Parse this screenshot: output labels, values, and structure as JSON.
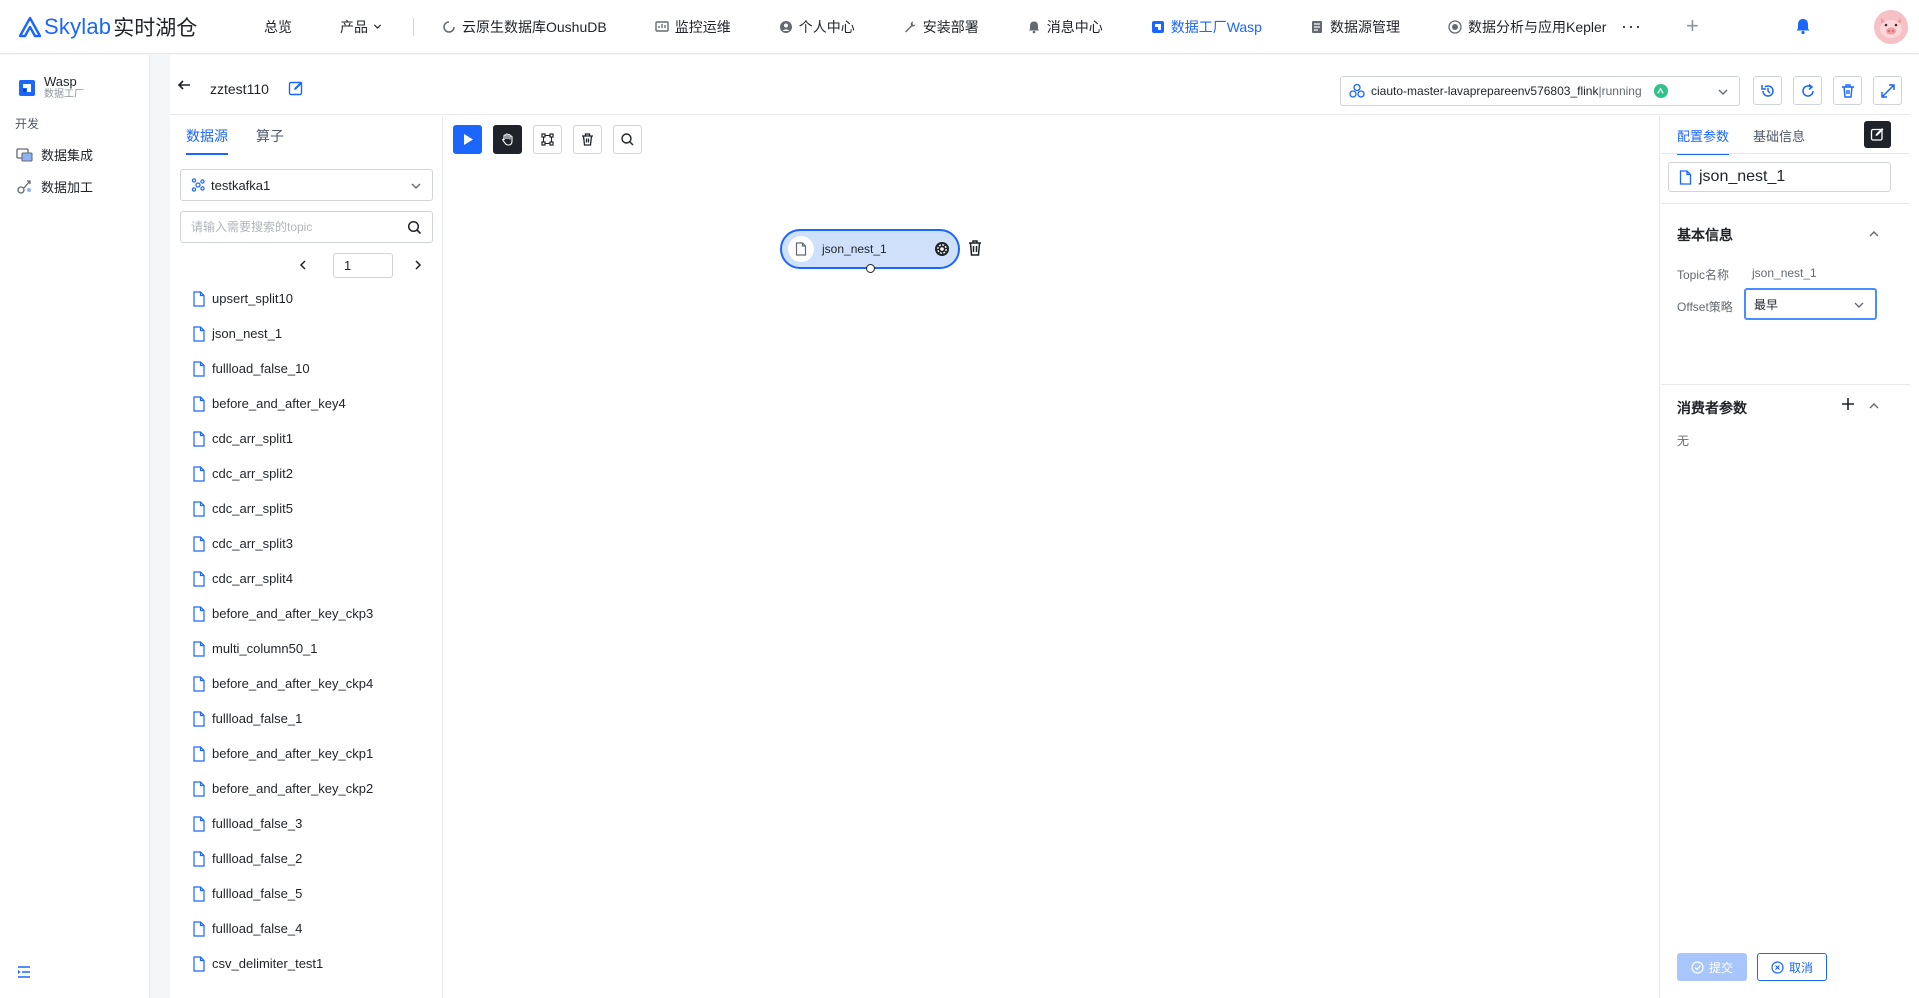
{
  "brand": {
    "name": "Skylab",
    "name_cn": "实时湖仓"
  },
  "nav": {
    "items": [
      {
        "label": "总览"
      },
      {
        "label": "产品"
      },
      {
        "label": "云原生数据库OushuDB"
      },
      {
        "label": "监控运维"
      },
      {
        "label": "个人中心"
      },
      {
        "label": "安装部署"
      },
      {
        "label": "消息中心"
      },
      {
        "label": "数据工厂Wasp"
      },
      {
        "label": "数据源管理"
      },
      {
        "label": "数据分析与应用Kepler"
      }
    ],
    "more": "···",
    "add": "+"
  },
  "sidebar": {
    "app_title": "Wasp",
    "app_subtitle": "数据工厂",
    "group": "开发",
    "items": [
      {
        "label": "数据集成"
      },
      {
        "label": "数据加工"
      }
    ]
  },
  "job": {
    "name": "zztest110"
  },
  "cluster": {
    "name": "ciauto-master-lavaprepareenv576803_flink",
    "status": "running"
  },
  "source_panel": {
    "tabs": [
      {
        "label": "数据源"
      },
      {
        "label": "算子"
      }
    ],
    "kafka_source": "testkafka1",
    "search_placeholder": "请输入需要搜索的topic",
    "page": "1",
    "topics": [
      "upsert_split10",
      "json_nest_1",
      "fullload_false_10",
      "before_and_after_key4",
      "cdc_arr_split1",
      "cdc_arr_split2",
      "cdc_arr_split5",
      "cdc_arr_split3",
      "cdc_arr_split4",
      "before_and_after_key_ckp3",
      "multi_column50_1",
      "before_and_after_key_ckp4",
      "fullload_false_1",
      "before_and_after_key_ckp1",
      "before_and_after_key_ckp2",
      "fullload_false_3",
      "fullload_false_2",
      "fullload_false_5",
      "fullload_false_4",
      "csv_delimiter_test1"
    ]
  },
  "canvas": {
    "node_label": "json_nest_1"
  },
  "config": {
    "tabs": [
      {
        "label": "配置参数"
      },
      {
        "label": "基础信息"
      }
    ],
    "node_name": "json_nest_1",
    "basic_title": "基本信息",
    "topic_label": "Topic名称",
    "topic_value": "json_nest_1",
    "offset_label": "Offset策略",
    "offset_value": "最早",
    "consumer_title": "消费者参数",
    "consumer_empty": "无",
    "submit_label": "提交",
    "cancel_label": "取消"
  },
  "colors": {
    "primary": "#1a66ff",
    "running": "#2fc28a",
    "dark": "#1f2329"
  }
}
